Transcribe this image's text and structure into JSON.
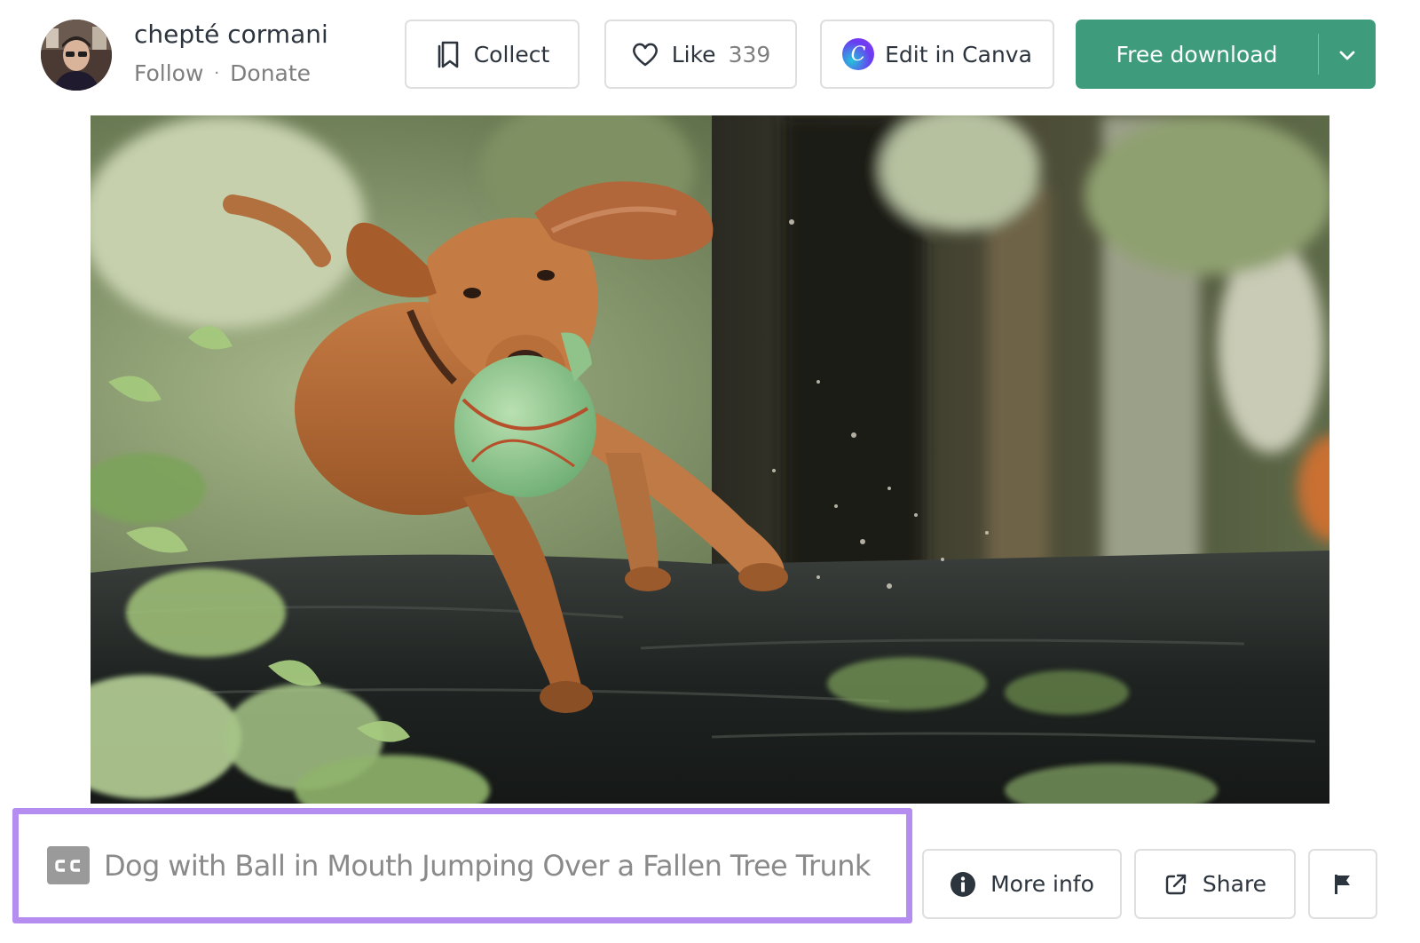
{
  "author": {
    "name": "chepté cormani",
    "follow_label": "Follow",
    "separator": "·",
    "donate_label": "Donate"
  },
  "toolbar": {
    "collect_label": "Collect",
    "like_label": "Like",
    "like_count": "339",
    "canva_label": "Edit in Canva",
    "download_label": "Free download"
  },
  "photo": {
    "alt": "Dog with Ball in Mouth Jumping Over a Fallen Tree Trunk"
  },
  "caption": {
    "license_badge": "CC",
    "title": "Dog with Ball in Mouth Jumping Over a Fallen Tree Trunk"
  },
  "actions": {
    "more_info_label": "More info",
    "share_label": "Share"
  },
  "colors": {
    "accent_green": "#3e9c7c",
    "highlight_purple": "#b58df0",
    "border_gray": "#dfdfe0",
    "text_dark": "#2c343e",
    "text_muted": "#7f7f7f"
  },
  "icons": {
    "collect": "bookmark-icon",
    "like": "heart-icon",
    "canva": "canva-logo-icon",
    "download_menu": "chevron-down-icon",
    "license": "cc-icon",
    "more_info": "info-icon",
    "share": "external-link-icon",
    "report": "flag-icon"
  }
}
